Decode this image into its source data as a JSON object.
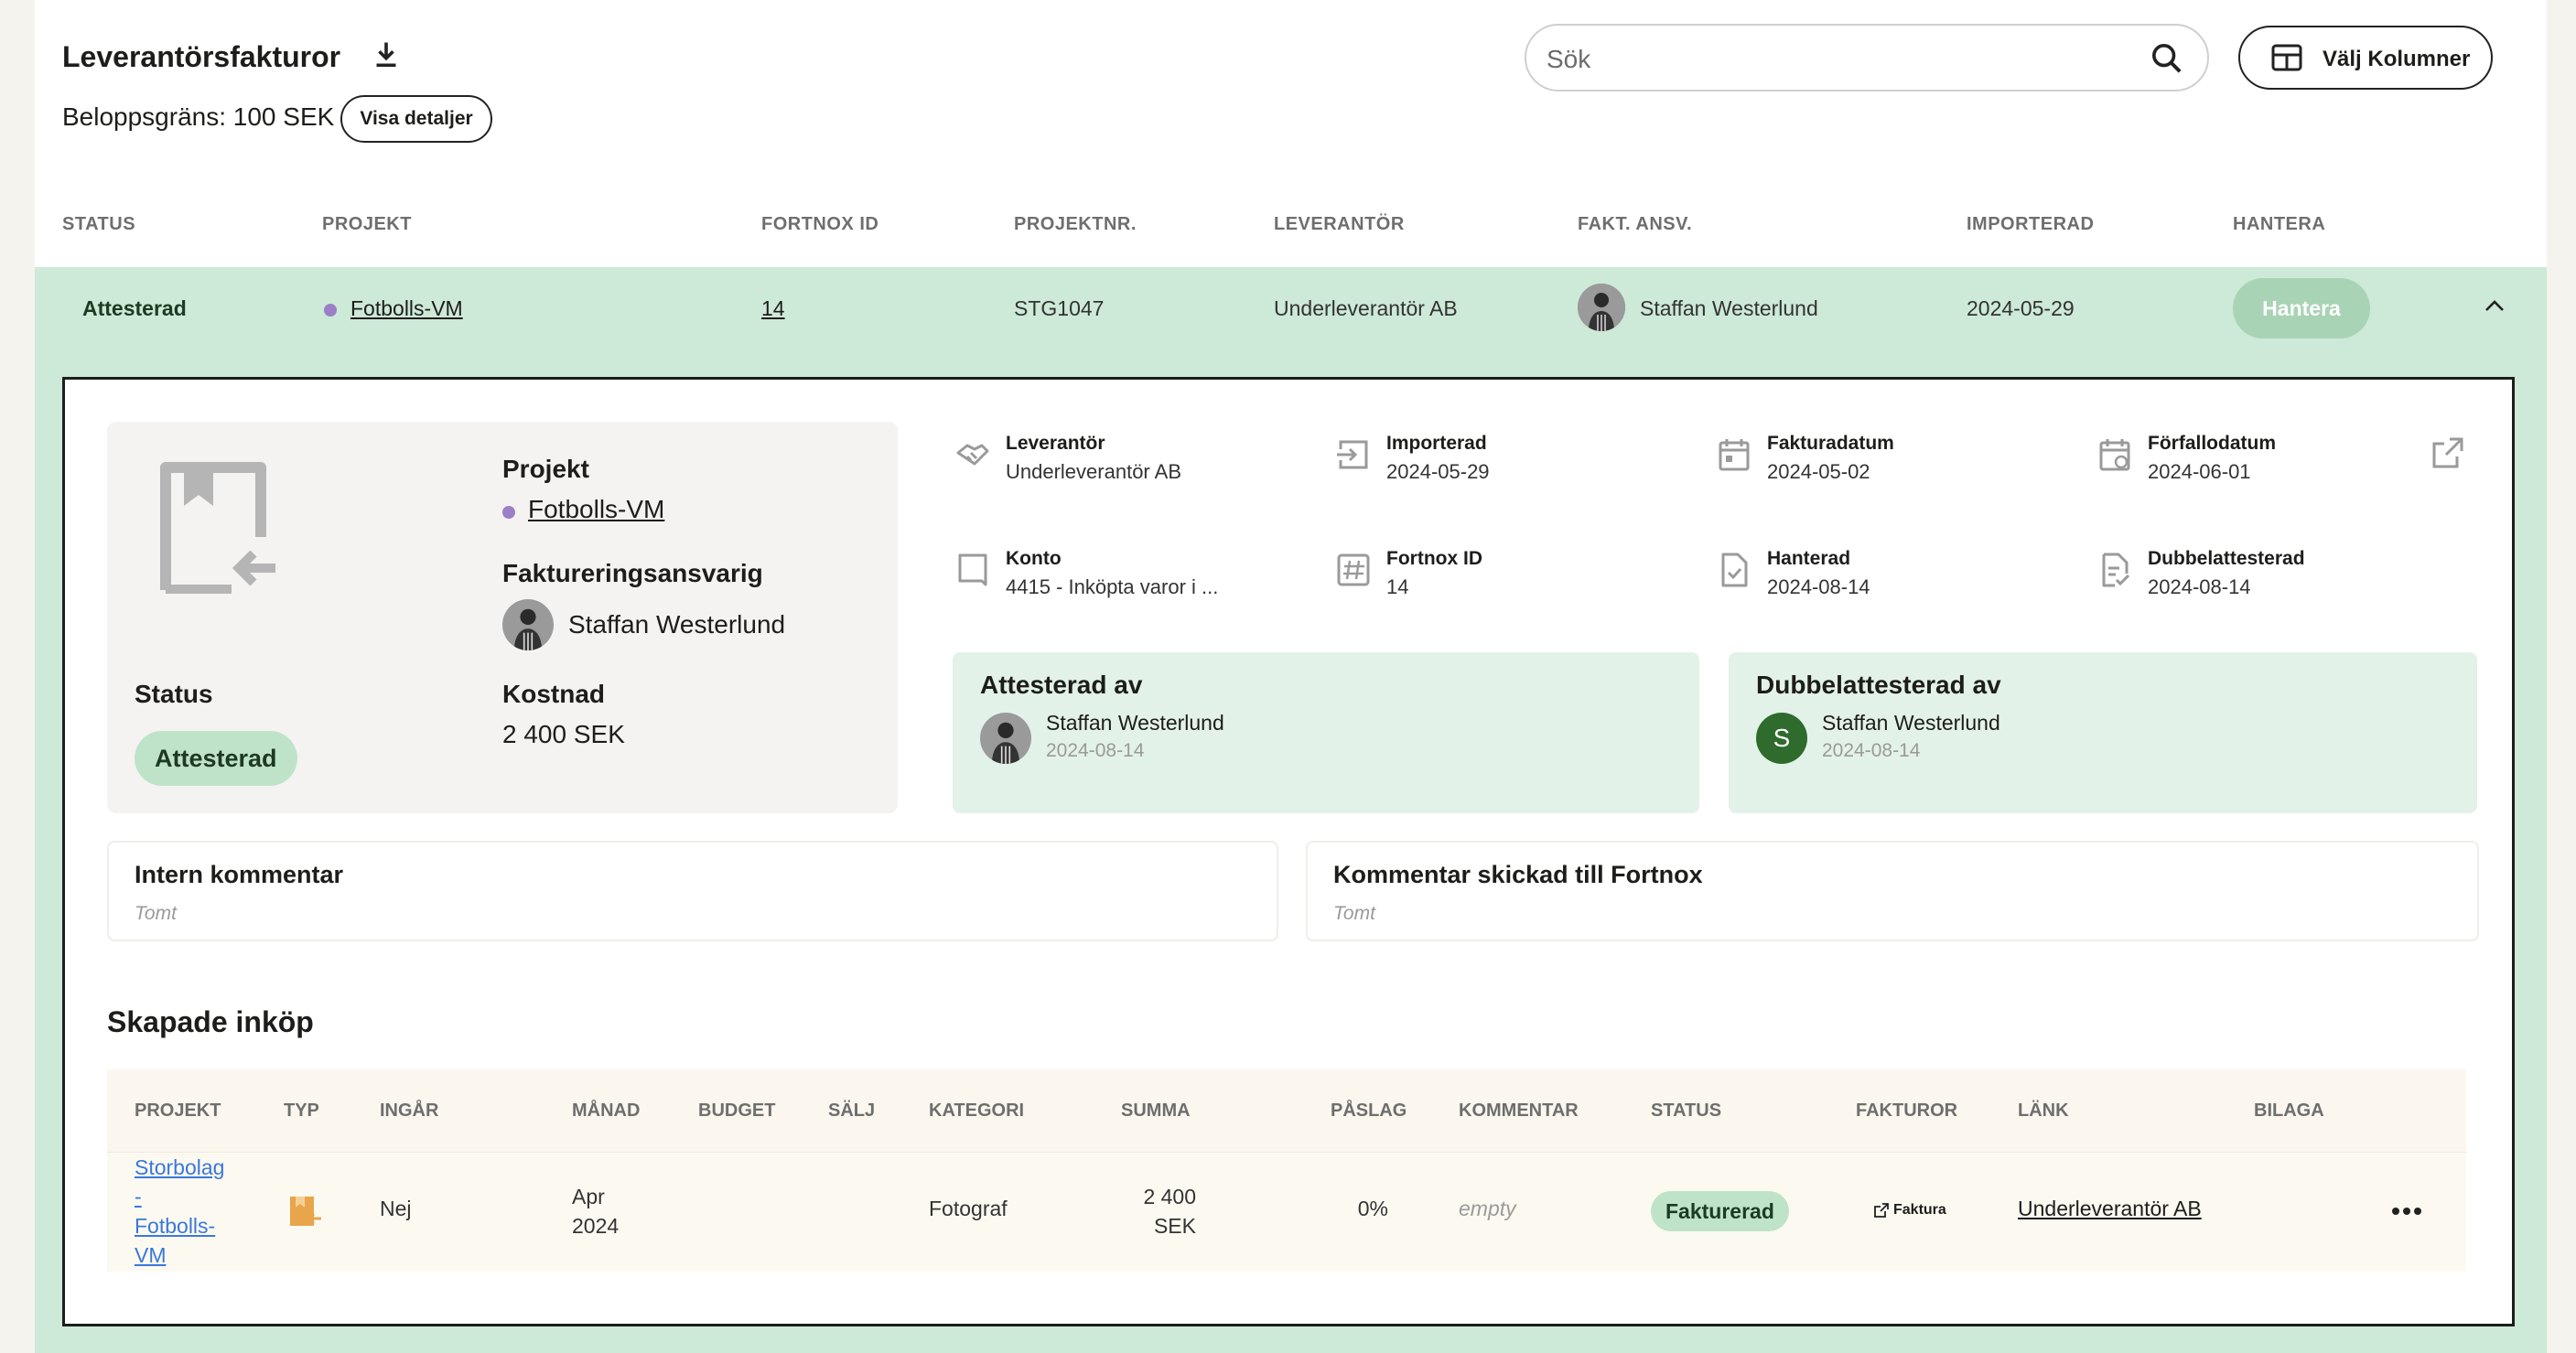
{
  "header": {
    "title": "Leverantörsfakturor",
    "limit_label": "Beloppsgräns: 100 SEK",
    "details_button": "Visa detaljer",
    "search_placeholder": "Sök",
    "columns_button": "Välj Kolumner"
  },
  "table": {
    "headers": [
      "STATUS",
      "PROJEKT",
      "FORTNOX ID",
      "PROJEKTNR.",
      "LEVERANTÖR",
      "FAKT. ANSV.",
      "IMPORTERAD",
      "HANTERA"
    ],
    "row": {
      "status": "Attesterad",
      "project": "Fotbolls-VM",
      "fortnox_id": "14",
      "project_nr": "STG1047",
      "supplier": "Underleverantör AB",
      "responsible": "Staffan Westerlund",
      "imported": "2024-05-29",
      "action": "Hantera"
    }
  },
  "detail": {
    "project_label": "Projekt",
    "project_value": "Fotbolls-VM",
    "responsible_label": "Faktureringsansvarig",
    "responsible_value": "Staffan Westerlund",
    "status_label": "Status",
    "status_value": "Attesterad",
    "cost_label": "Kostnad",
    "cost_value": "2 400 SEK",
    "info": {
      "supplier": {
        "label": "Leverantör",
        "value": "Underleverantör AB"
      },
      "imported": {
        "label": "Importerad",
        "value": "2024-05-29"
      },
      "invoice_date": {
        "label": "Fakturadatum",
        "value": "2024-05-02"
      },
      "due_date": {
        "label": "Förfallodatum",
        "value": "2024-06-01"
      },
      "account": {
        "label": "Konto",
        "value": "4415 - Inköpta varor i ..."
      },
      "fortnox_id": {
        "label": "Fortnox ID",
        "value": "14"
      },
      "handled": {
        "label": "Hanterad",
        "value": "2024-08-14"
      },
      "double_attested": {
        "label": "Dubbelattesterad",
        "value": "2024-08-14"
      }
    },
    "attested_by": {
      "title": "Attesterad av",
      "name": "Staffan Westerlund",
      "date": "2024-08-14"
    },
    "double_attested_by": {
      "title": "Dubbelattesterad av",
      "name": "Staffan Westerlund",
      "date": "2024-08-14",
      "initial": "S"
    },
    "internal_comment": {
      "title": "Intern kommentar",
      "value": "Tomt"
    },
    "fortnox_comment": {
      "title": "Kommentar skickad till Fortnox",
      "value": "Tomt"
    }
  },
  "purchases": {
    "title": "Skapade inköp",
    "headers": [
      "PROJEKT",
      "TYP",
      "INGÅR",
      "MÅNAD",
      "BUDGET",
      "SÄLJ",
      "KATEGORI",
      "SUMMA",
      "PÅSLAG",
      "KOMMENTAR",
      "STATUS",
      "FAKTUROR",
      "LÄNK",
      "BILAGA"
    ],
    "row": {
      "project_lines": [
        "Storbolag",
        "-",
        "Fotbolls-",
        "VM"
      ],
      "included": "Nej",
      "month_lines": [
        "Apr",
        "2024"
      ],
      "category": "Fotograf",
      "sum_lines": [
        "2 400",
        "SEK"
      ],
      "markup": "0%",
      "comment": "empty",
      "status": "Fakturerad",
      "invoices": "Faktura",
      "link": "Underleverantör AB"
    }
  },
  "colors": {
    "row_green": "#cde9d7",
    "accent_green": "#2e7d32",
    "dot_purple": "#9b7fc7",
    "link_blue": "#3a78d8"
  }
}
